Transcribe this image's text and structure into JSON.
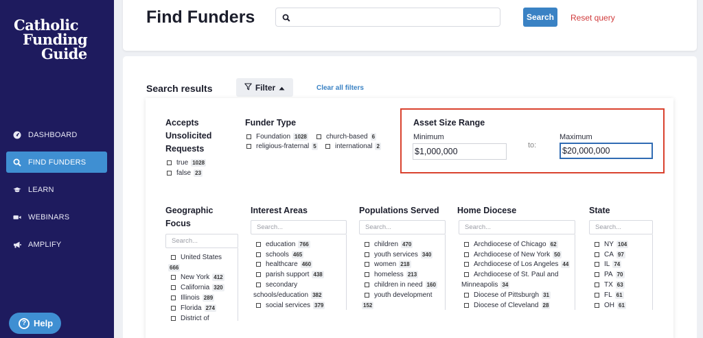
{
  "sidebar": {
    "logo_lines": [
      "Catholic",
      "Funding",
      "Guide"
    ],
    "nav": [
      {
        "label": "DASHBOARD",
        "icon": "gauge-icon"
      },
      {
        "label": "FIND FUNDERS",
        "icon": "search-icon"
      },
      {
        "label": "LEARN",
        "icon": "graduation-cap-icon"
      },
      {
        "label": "WEBINARS",
        "icon": "video-icon"
      },
      {
        "label": "AMPLIFY",
        "icon": "megaphone-icon"
      }
    ],
    "help_label": "Help"
  },
  "header": {
    "title": "Find Funders",
    "search_value": "",
    "search_button": "Search",
    "reset_link": "Reset query"
  },
  "results": {
    "title": "Search results",
    "filter_button": "Filter",
    "clear_link": "Clear all filters"
  },
  "filters": {
    "accepts_unsolicited": {
      "title_lines": [
        "Accepts",
        "Unsolicited",
        "Requests"
      ],
      "options": [
        {
          "label": "true",
          "count": "1028"
        },
        {
          "label": "false",
          "count": "23"
        }
      ]
    },
    "funder_type": {
      "title": "Funder Type",
      "options": [
        {
          "label": "Foundation",
          "count": "1028"
        },
        {
          "label": "church-based",
          "count": "6"
        },
        {
          "label": "religious-fraternal",
          "count": "5"
        },
        {
          "label": "international",
          "count": "2"
        }
      ]
    },
    "asset_size": {
      "title": "Asset Size Range",
      "min_label": "Minimum",
      "min_value": "$1,000,000",
      "to_label": "to:",
      "max_label": "Maximum",
      "max_value": "$20,000,000",
      "highlight_color": "#d9412d"
    },
    "geographic_focus": {
      "title_lines": [
        "Geographic",
        "Focus"
      ],
      "search_placeholder": "Search...",
      "options": [
        {
          "label": "United States",
          "count": "666"
        },
        {
          "label": "New York",
          "count": "412"
        },
        {
          "label": "California",
          "count": "320"
        },
        {
          "label": "Illinois",
          "count": "289"
        },
        {
          "label": "Florida",
          "count": "274"
        },
        {
          "label": "District of",
          "count": ""
        }
      ]
    },
    "interest_areas": {
      "title": "Interest Areas",
      "search_placeholder": "Search...",
      "options": [
        {
          "label": "education",
          "count": "766"
        },
        {
          "label": "schools",
          "count": "465"
        },
        {
          "label": "healthcare",
          "count": "460"
        },
        {
          "label": "parish support",
          "count": "438"
        },
        {
          "label": "secondary",
          "count": ""
        },
        {
          "label": "schools/education",
          "count": "382"
        },
        {
          "label": "social services",
          "count": "379"
        }
      ]
    },
    "populations_served": {
      "title": "Populations Served",
      "search_placeholder": "Search...",
      "options": [
        {
          "label": "children",
          "count": "470"
        },
        {
          "label": "youth services",
          "count": "340"
        },
        {
          "label": "women",
          "count": "218"
        },
        {
          "label": "homeless",
          "count": "213"
        },
        {
          "label": "children in need",
          "count": "160"
        },
        {
          "label": "youth development",
          "count": ""
        },
        {
          "label": "",
          "count": "152"
        }
      ]
    },
    "home_diocese": {
      "title": "Home Diocese",
      "search_placeholder": "Search...",
      "options": [
        {
          "label": "Archdiocese of Chicago",
          "count": "62"
        },
        {
          "label": "Archdiocese of New York",
          "count": "50"
        },
        {
          "label": "Archdiocese of Los Angeles",
          "count": "44"
        },
        {
          "label": "Archdiocese of St. Paul and",
          "count": ""
        },
        {
          "label": "Minneapolis",
          "count": "34"
        },
        {
          "label": "Diocese of Pittsburgh",
          "count": "31"
        },
        {
          "label": "Diocese of Cleveland",
          "count": "28"
        }
      ]
    },
    "state": {
      "title": "State",
      "search_placeholder": "Search...",
      "options": [
        {
          "label": "NY",
          "count": "104"
        },
        {
          "label": "CA",
          "count": "97"
        },
        {
          "label": "IL",
          "count": "74"
        },
        {
          "label": "PA",
          "count": "70"
        },
        {
          "label": "TX",
          "count": "63"
        },
        {
          "label": "FL",
          "count": "61"
        },
        {
          "label": "OH",
          "count": "61"
        }
      ]
    }
  }
}
